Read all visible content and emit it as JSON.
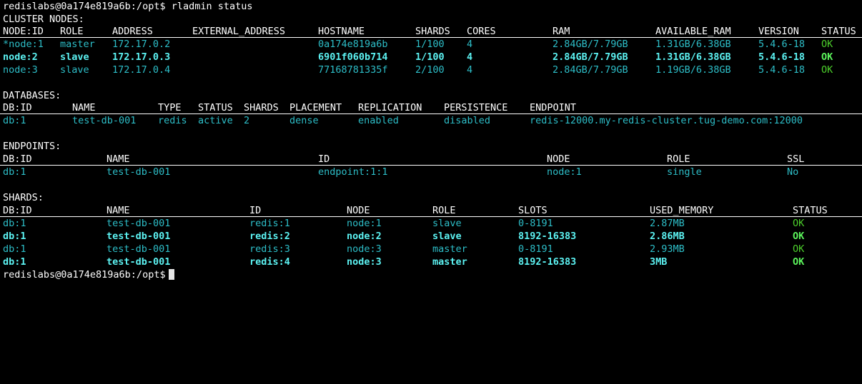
{
  "prompt_top": "redislabs@0a174e819a6b:/opt$ rladmin status",
  "cluster": {
    "title": "CLUSTER NODES:",
    "headers": [
      "NODE:ID",
      "ROLE",
      "ADDRESS",
      "EXTERNAL_ADDRESS",
      "HOSTNAME",
      "SHARDS",
      "CORES",
      "RAM",
      "AVAILABLE_RAM",
      "VERSION",
      "STATUS"
    ],
    "rows": [
      [
        "*node:1",
        "master",
        "172.17.0.2",
        "",
        "0a174e819a6b",
        "1/100",
        "4",
        "2.84GB/7.79GB",
        "1.31GB/6.38GB",
        "5.4.6-18",
        "OK"
      ],
      [
        "node:2",
        "slave",
        "172.17.0.3",
        "",
        "6901f060b714",
        "1/100",
        "4",
        "2.84GB/7.79GB",
        "1.31GB/6.38GB",
        "5.4.6-18",
        "OK"
      ],
      [
        "node:3",
        "slave",
        "172.17.0.4",
        "",
        "77168781335f",
        "2/100",
        "4",
        "2.84GB/7.79GB",
        "1.19GB/6.38GB",
        "5.4.6-18",
        "OK"
      ]
    ]
  },
  "databases": {
    "title": "DATABASES:",
    "headers": [
      "DB:ID",
      "NAME",
      "TYPE",
      "STATUS",
      "SHARDS",
      "PLACEMENT",
      "REPLICATION",
      "PERSISTENCE",
      "ENDPOINT"
    ],
    "rows": [
      [
        "db:1",
        "test-db-001",
        "redis",
        "active",
        "2",
        "dense",
        "enabled",
        "disabled",
        "redis-12000.my-redis-cluster.tug-demo.com:12000"
      ]
    ]
  },
  "endpoints": {
    "title": "ENDPOINTS:",
    "headers": [
      "DB:ID",
      "NAME",
      "ID",
      "NODE",
      "ROLE",
      "SSL"
    ],
    "rows": [
      [
        "db:1",
        "test-db-001",
        "endpoint:1:1",
        "node:1",
        "single",
        "No"
      ]
    ]
  },
  "shards": {
    "title": "SHARDS:",
    "headers": [
      "DB:ID",
      "NAME",
      "ID",
      "NODE",
      "ROLE",
      "SLOTS",
      "USED_MEMORY",
      "STATUS"
    ],
    "rows": [
      [
        "db:1",
        "test-db-001",
        "redis:1",
        "node:1",
        "slave",
        "0-8191",
        "2.87MB",
        "OK"
      ],
      [
        "db:1",
        "test-db-001",
        "redis:2",
        "node:2",
        "slave",
        "8192-16383",
        "2.86MB",
        "OK"
      ],
      [
        "db:1",
        "test-db-001",
        "redis:3",
        "node:3",
        "master",
        "0-8191",
        "2.93MB",
        "OK"
      ],
      [
        "db:1",
        "test-db-001",
        "redis:4",
        "node:3",
        "master",
        "8192-16383",
        "3MB",
        "OK"
      ]
    ]
  },
  "prompt_bottom": "redislabs@0a174e819a6b:/opt$",
  "colors": {
    "background": "#000000",
    "text": "#ffffff",
    "cyan": "#2dbec8",
    "cyan_bright": "#5cf2f2",
    "green": "#4ccf2b",
    "green_bright": "#5cf55c"
  }
}
